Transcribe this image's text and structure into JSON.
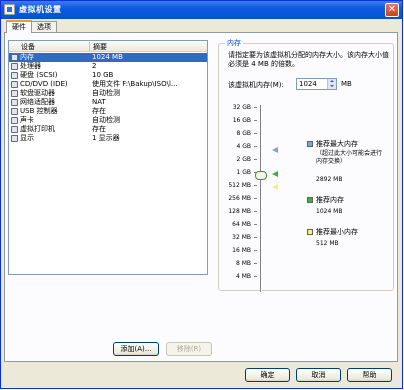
{
  "window": {
    "title": "虚拟机设置"
  },
  "tabs": [
    {
      "label": "硬件",
      "active": true
    },
    {
      "label": "选项",
      "active": false
    }
  ],
  "device_list": {
    "columns": [
      "设备",
      "摘要"
    ],
    "rows": [
      {
        "icon": "memory-icon",
        "name": "内存",
        "summary": "1024 MB",
        "selected": true
      },
      {
        "icon": "processor-icon",
        "name": "处理器",
        "summary": "2",
        "selected": false
      },
      {
        "icon": "hard-disk-icon",
        "name": "硬盘 (SCSI)",
        "summary": "10 GB",
        "selected": false
      },
      {
        "icon": "cd-dvd-icon",
        "name": "CD/DVD (IDE)",
        "summary": "使用文件 F:\\Bakup\\ISO\\l...",
        "selected": false
      },
      {
        "icon": "floppy-icon",
        "name": "软盘驱动器",
        "summary": "自动检测",
        "selected": false
      },
      {
        "icon": "network-adapter-icon",
        "name": "网络适配器",
        "summary": "NAT",
        "selected": false
      },
      {
        "icon": "usb-controller-icon",
        "name": "USB 控制器",
        "summary": "存在",
        "selected": false
      },
      {
        "icon": "sound-card-icon",
        "name": "声卡",
        "summary": "自动检测",
        "selected": false
      },
      {
        "icon": "printer-icon",
        "name": "虚拟打印机",
        "summary": "存在",
        "selected": false
      },
      {
        "icon": "display-icon",
        "name": "显示",
        "summary": "1 显示器",
        "selected": false
      }
    ]
  },
  "list_buttons": {
    "add": "添加(A)...",
    "remove": "移除(R)"
  },
  "memory": {
    "group_label": "内存",
    "description": "请指定要为该虚拟机分配的内存大小。该内存大小值必须是 4 MB 的倍数。",
    "field_label": "该虚拟机内存(M):",
    "value": "1024",
    "unit": "MB",
    "scale_labels": [
      "32 GB",
      "16 GB",
      "8 GB",
      "4 GB",
      "2 GB",
      "1 GB",
      "512 MB",
      "256 MB",
      "128 MB",
      "64 MB",
      "32 MB",
      "16 MB",
      "8 MB",
      "4 MB"
    ],
    "current_mb": 1024,
    "legend": [
      {
        "color": "#7fa3d4",
        "label": "推荐最大内存",
        "note": "（超过此大小可能会进行内存交换）",
        "value": "2892 MB"
      },
      {
        "color": "#3fae3f",
        "label": "推荐内存",
        "note": "",
        "value": "1024 MB"
      },
      {
        "color": "#f2ee82",
        "label": "推荐最小内存",
        "note": "",
        "value": "512 MB"
      }
    ]
  },
  "footer_buttons": {
    "ok": "确定",
    "cancel": "取消",
    "help": "帮助"
  }
}
